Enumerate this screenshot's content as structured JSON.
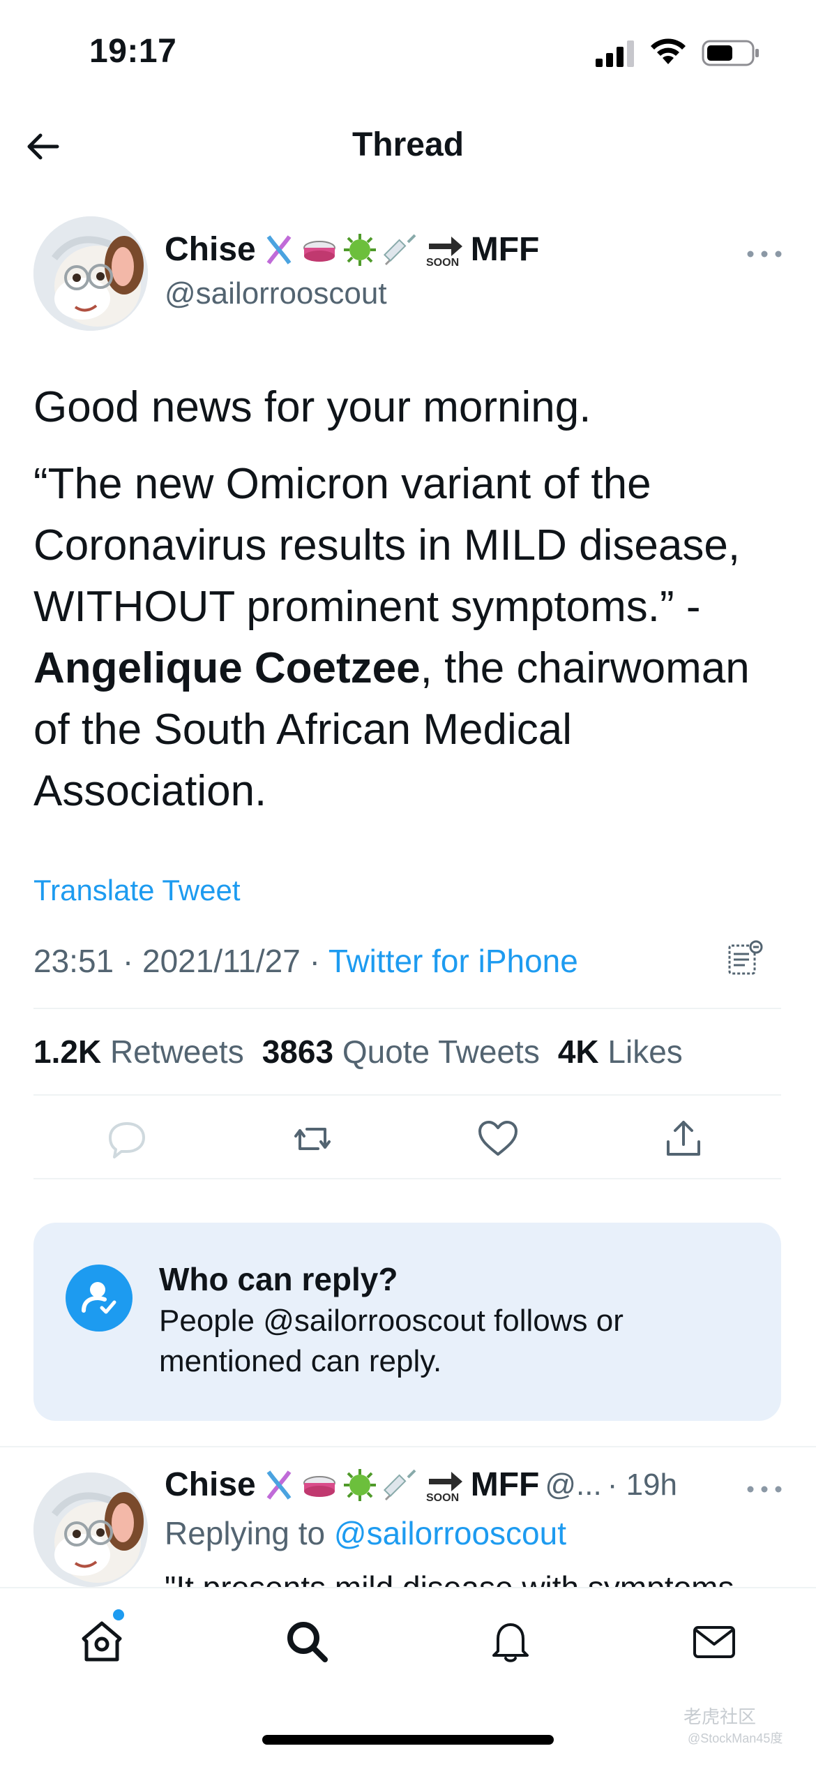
{
  "status_bar": {
    "time": "19:17"
  },
  "header": {
    "title": "Thread"
  },
  "tweet": {
    "display_name": "Chise",
    "name_suffix": "MFF",
    "soon_label": "SOON",
    "handle": "@sailorrooscout",
    "paragraph_1": "Good news for your morning.",
    "quote": "“The new Omicron variant of the Coronavirus results in MILD disease, WITHOUT prominent symptoms.”",
    "dash": "-",
    "attribution_name": "Angelique Coetzee",
    "attribution_rest": ", the chairwoman of the South African Medical Association.",
    "translate_label": "Translate Tweet",
    "time": "23:51",
    "date": "2021/11/27",
    "separator": "·",
    "source": "Twitter for iPhone",
    "stats": {
      "retweets_count": "1.2K",
      "retweets_label": "Retweets",
      "quotes_count": "3863",
      "quotes_label": "Quote Tweets",
      "likes_count": "4K",
      "likes_label": "Likes"
    },
    "icons": [
      "reply-icon",
      "retweet-icon",
      "like-icon",
      "share-icon"
    ]
  },
  "reply_restriction": {
    "title": "Who can reply?",
    "description": "People @sailorrooscout follows or mentioned can reply."
  },
  "reply_tweet": {
    "display_name": "Chise",
    "name_suffix": "MFF",
    "soon_label": "SOON",
    "handle_truncated": "@...",
    "age": "· 19h",
    "replying_prefix": "Replying to",
    "replying_handle": "@sailorrooscout",
    "snippet": "\"It presents mild disease with symptoms"
  },
  "tab_bar": {
    "tabs": [
      "home-icon",
      "search-icon",
      "notifications-icon",
      "messages-icon"
    ]
  },
  "watermark": {
    "line1": "老虎社区",
    "line2": "@StockMan45度"
  },
  "colors": {
    "accent": "#1d9bf0",
    "text": "#0f1419",
    "muted": "#536471",
    "card": "#e8f0fa"
  }
}
